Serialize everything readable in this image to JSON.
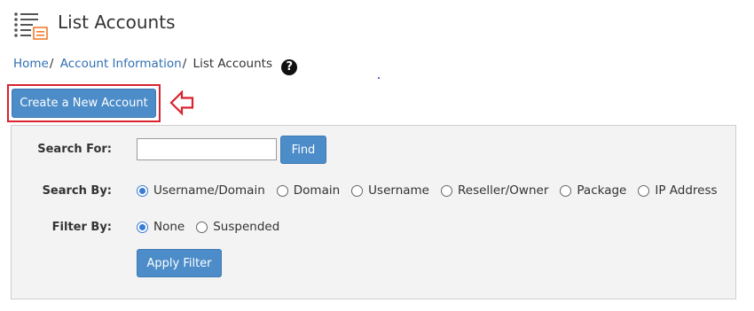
{
  "page": {
    "title": "List Accounts",
    "icon": "list-accounts-icon"
  },
  "breadcrumb": {
    "items": [
      "Home",
      "Account Information",
      "List Accounts"
    ],
    "separator": "/",
    "help_icon": "question-circle-icon"
  },
  "actions": {
    "create_label": "Create a New Account",
    "arrow_icon": "left-arrow-icon"
  },
  "search": {
    "label": "Search For:",
    "value": "",
    "placeholder": "",
    "find_label": "Find"
  },
  "search_by": {
    "label": "Search By:",
    "selected": "Username/Domain",
    "options": [
      "Username/Domain",
      "Domain",
      "Username",
      "Reseller/Owner",
      "Package",
      "IP Address"
    ]
  },
  "filter_by": {
    "label": "Filter By:",
    "selected": "None",
    "options": [
      "None",
      "Suspended"
    ],
    "apply_label": "Apply Filter"
  },
  "colors": {
    "accent": "#4c8cc8",
    "link": "#2f6fb3",
    "highlight": "#d9232f",
    "panel_bg": "#f3f3f3"
  }
}
